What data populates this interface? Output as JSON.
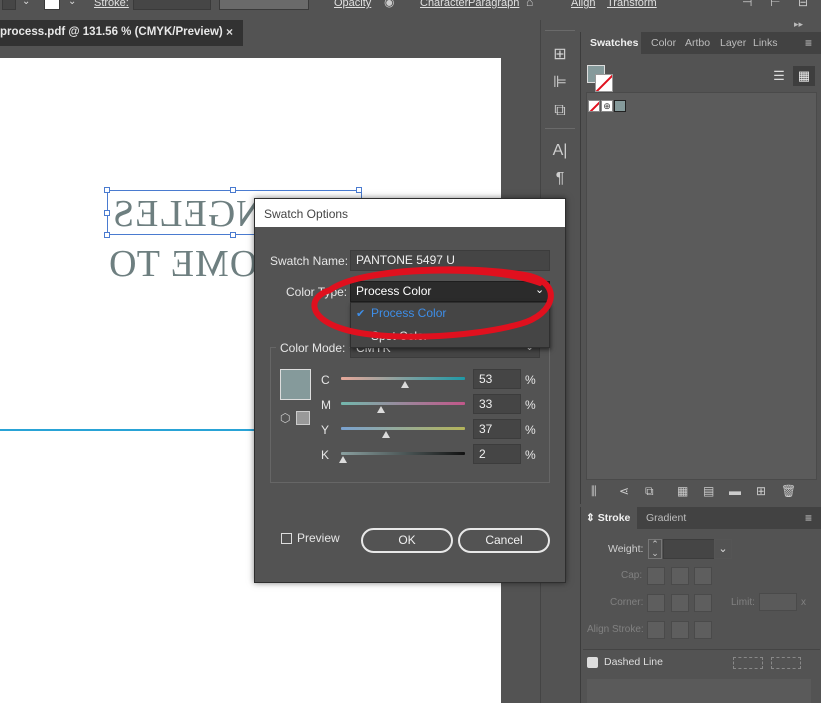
{
  "control_bar": {
    "stroke_label": "Stroke:",
    "opacity_label": "Opacity",
    "character_label": "Character",
    "paragraph_label": "Paragraph",
    "align_label": "Align",
    "transform_label": "Transform"
  },
  "document": {
    "tab_title": "process.pdf @ 131.56 % (CMYK/Preview)",
    "close_glyph": "×",
    "line1": "NGELES",
    "line2": "OME TO"
  },
  "swatches_panel": {
    "tabs": [
      "Swatches",
      "Color",
      "Artbo",
      "Layer",
      "Links"
    ],
    "active_tab": "Swatches"
  },
  "stroke_panel": {
    "tabs": [
      "Stroke",
      "Gradient"
    ],
    "weight_label": "Weight:",
    "cap_label": "Cap:",
    "corner_label": "Corner:",
    "limit_label": "Limit:",
    "limit_unit": "x",
    "align_stroke_label": "Align Stroke:",
    "dashed_line_label": "Dashed Line"
  },
  "dialog": {
    "title": "Swatch Options",
    "swatch_name_label": "Swatch Name:",
    "swatch_name_value": "PANTONE 5497 U",
    "color_type_label": "Color Type:",
    "color_type_value": "Process Color",
    "color_mode_label": "Color Mode:",
    "color_mode_value": "CMYK",
    "channels": [
      {
        "label": "C",
        "value": "53",
        "unit": "%"
      },
      {
        "label": "M",
        "value": "33",
        "unit": "%"
      },
      {
        "label": "Y",
        "value": "37",
        "unit": "%"
      },
      {
        "label": "K",
        "value": "2",
        "unit": "%"
      }
    ],
    "preview_label": "Preview",
    "ok_label": "OK",
    "cancel_label": "Cancel",
    "swatch_color": "#859a9b"
  },
  "dropdown": {
    "options": [
      "Process Color",
      "Spot Color"
    ],
    "selected": "Process Color",
    "check_glyph": "✔"
  },
  "colors": {
    "highlight_blue": "#3e8ee8",
    "annotation_red": "#e0101e",
    "selection_blue": "#4a7bd0",
    "guide_cyan": "#29a3d6"
  }
}
